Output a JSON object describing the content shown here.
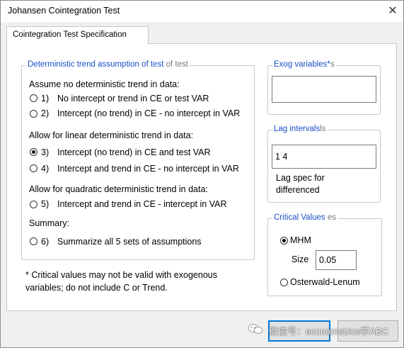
{
  "window": {
    "title": "Johansen Cointegration Test",
    "close_glyph": "✕"
  },
  "tab": {
    "label": "Cointegration Test Specification"
  },
  "trend_group": {
    "legend": "Deterministic trend assumption of test",
    "legend_ghost": "of test",
    "sections": [
      {
        "header": "Assume no deterministic trend in data:",
        "options": [
          {
            "num": "1)",
            "label": "No intercept or trend in CE or test VAR",
            "checked": false
          },
          {
            "num": "2)",
            "label": "Intercept (no trend) in CE - no intercept in VAR",
            "checked": false
          }
        ]
      },
      {
        "header": "Allow for linear deterministic trend in data:",
        "options": [
          {
            "num": "3)",
            "label": "Intercept (no trend) in CE and test VAR",
            "checked": true
          },
          {
            "num": "4)",
            "label": "Intercept and trend in CE - no intercept in VAR",
            "checked": false
          }
        ]
      },
      {
        "header": "Allow for quadratic deterministic trend in data:",
        "options": [
          {
            "num": "5)",
            "label": "Intercept and trend in CE - intercept in VAR",
            "checked": false
          }
        ]
      },
      {
        "header": "Summary:",
        "options": [
          {
            "num": "6)",
            "label": "Summarize all 5 sets of assumptions",
            "checked": false
          }
        ]
      }
    ]
  },
  "note": {
    "line1": "* Critical values may not be valid with exogenous",
    "line2": "variables; do not include C or Trend."
  },
  "exog": {
    "legend": "Exog variables*",
    "legend_ghost": "s",
    "value": ""
  },
  "lag": {
    "legend": "Lag intervals",
    "legend_ghost": "ls",
    "value": "1 4",
    "spec_line1": "Lag spec for",
    "spec_line2": "differenced"
  },
  "critical": {
    "legend": "Critical Values",
    "legend_ghost": "es",
    "option_mhm": "MHM",
    "mhm_checked": true,
    "size_label": "Size",
    "size_value": "0.05",
    "option_ow": "Osterwald-Lenum",
    "ow_checked": false
  },
  "buttons": {
    "ok": "",
    "cancel": ""
  },
  "watermark": {
    "text": "微信号：econometrics学ABC"
  }
}
